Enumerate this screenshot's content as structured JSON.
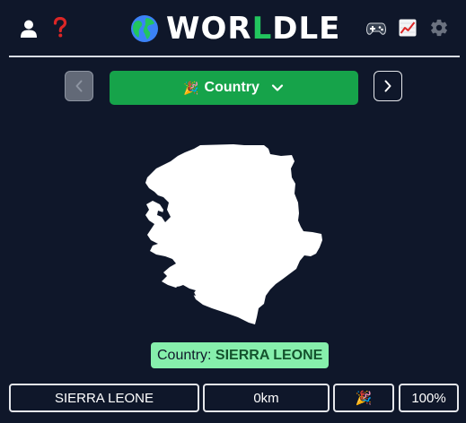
{
  "header": {
    "title_prefix": "WOR",
    "title_green": "L",
    "title_suffix": "DLE",
    "icons": {
      "account": "user-icon",
      "help": "question-icon",
      "games": "gamepad-icon",
      "stats": "chart-icon",
      "settings": "gear-icon"
    }
  },
  "nav": {
    "prev_symbol": "‹",
    "next_symbol": "›",
    "dropdown_emoji": "🎉",
    "dropdown_label": "Country",
    "dropdown_chevron": "⌄"
  },
  "answer": {
    "prefix": "Country:",
    "country": "SIERRA LEONE"
  },
  "guess": {
    "name": "SIERRA LEONE",
    "distance": "0km",
    "direction": "🎉",
    "proximity": "100%"
  },
  "colors": {
    "background": "#0f172a",
    "accent_green": "#16a34a",
    "answer_bg": "#86efac"
  }
}
